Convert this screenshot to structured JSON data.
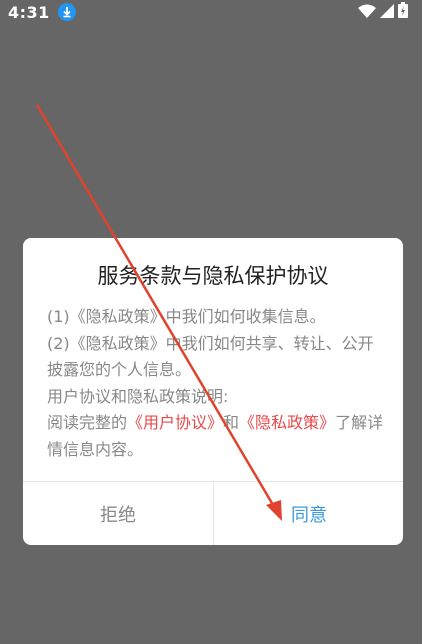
{
  "status_bar": {
    "time": "4:31",
    "icons": [
      "download-notification-icon",
      "wifi-icon",
      "cellular-signal-icon",
      "battery-icon"
    ]
  },
  "dialog": {
    "title": "服务条款与隐私保护协议",
    "line1": "(1)《隐私政策》中我们如何收集信息。",
    "line2": "(2)《隐私政策》中我们如何共享、转让、公开披露您的个人信息。",
    "line3": "用户协议和隐私政策说明:",
    "line4_prefix": "阅读完整的",
    "link_user_agreement": "《用户协议》",
    "line4_mid": "和",
    "link_privacy_policy": "《隐私政策》",
    "line4_suffix": "了解详情信息内容。",
    "reject_label": "拒绝",
    "agree_label": "同意"
  },
  "colors": {
    "overlay": "#666666",
    "link": "#e94a4a",
    "agree": "#3a9bd8",
    "arrow": "#e0432d"
  }
}
